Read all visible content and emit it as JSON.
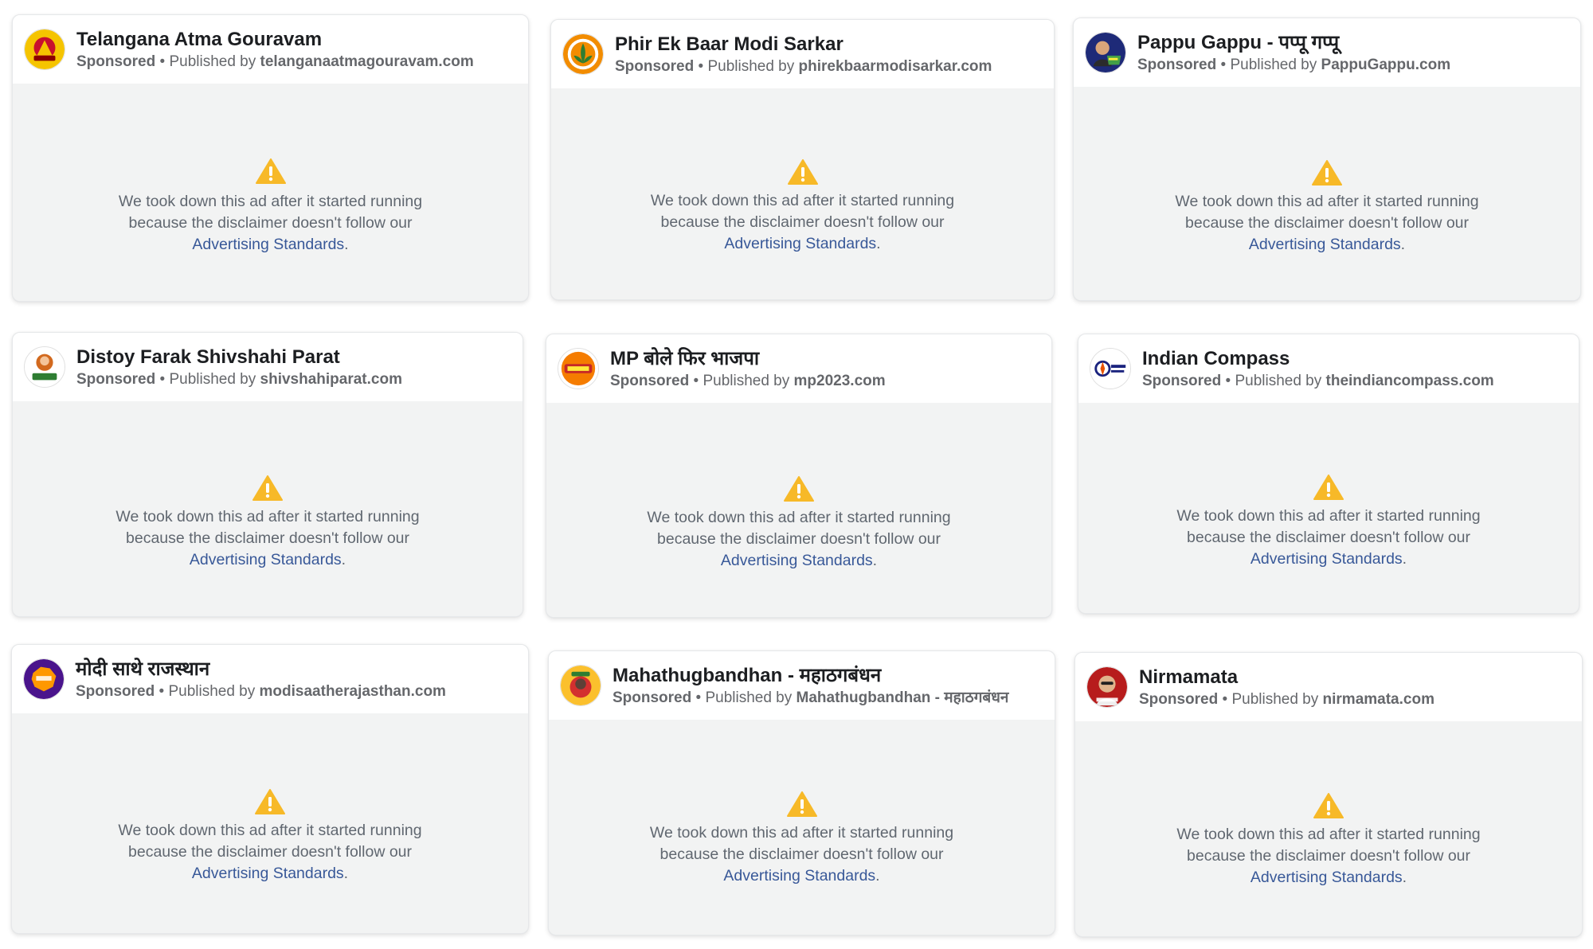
{
  "common": {
    "sponsored": "Sponsored",
    "dot": " • ",
    "published_by": "Published by ",
    "msg_line1": "We took down this ad after it started running",
    "msg_line2": "because the disclaimer doesn't follow our",
    "link": "Advertising Standards",
    "period": "."
  },
  "colors": {
    "warning": "#f7b928",
    "link": "#385898",
    "muted_text": "#606770",
    "card_bg": "#f2f3f3"
  },
  "cards": [
    {
      "name": "Telangana Atma Gouravam",
      "publisher": "telanganaatmagouravam.com",
      "avatar_icon": "telangana-logo-icon"
    },
    {
      "name": "Phir Ek Baar Modi Sarkar",
      "publisher": "phirekbaarmodisarkar.com",
      "avatar_icon": "lotus-badge-icon"
    },
    {
      "name": "Pappu Gappu - पप्पू गप्पू",
      "publisher": "PappuGappu.com",
      "avatar_icon": "pappu-gappu-logo-icon"
    },
    {
      "name": "Distoy Farak Shivshahi Parat",
      "publisher": "shivshahiparat.com",
      "avatar_icon": "shivshahi-logo-icon"
    },
    {
      "name": "MP बोले फिर भाजपा",
      "publisher": "mp2023.com",
      "avatar_icon": "mp-bjp-logo-icon"
    },
    {
      "name": "Indian Compass",
      "publisher": "theindiancompass.com",
      "avatar_icon": "compass-logo-icon"
    },
    {
      "name": "मोदी साथे राजस्थान",
      "publisher": "modisaatherajasthan.com",
      "avatar_icon": "rajasthan-map-icon"
    },
    {
      "name": "Mahathugbandhan - महाठगबंधन",
      "publisher": "Mahathugbandhan - महाठगबंधन",
      "avatar_icon": "mahathugbandhan-logo-icon"
    },
    {
      "name": "Nirmamata",
      "publisher": "nirmamata.com",
      "avatar_icon": "nirmamata-caricature-icon"
    }
  ]
}
